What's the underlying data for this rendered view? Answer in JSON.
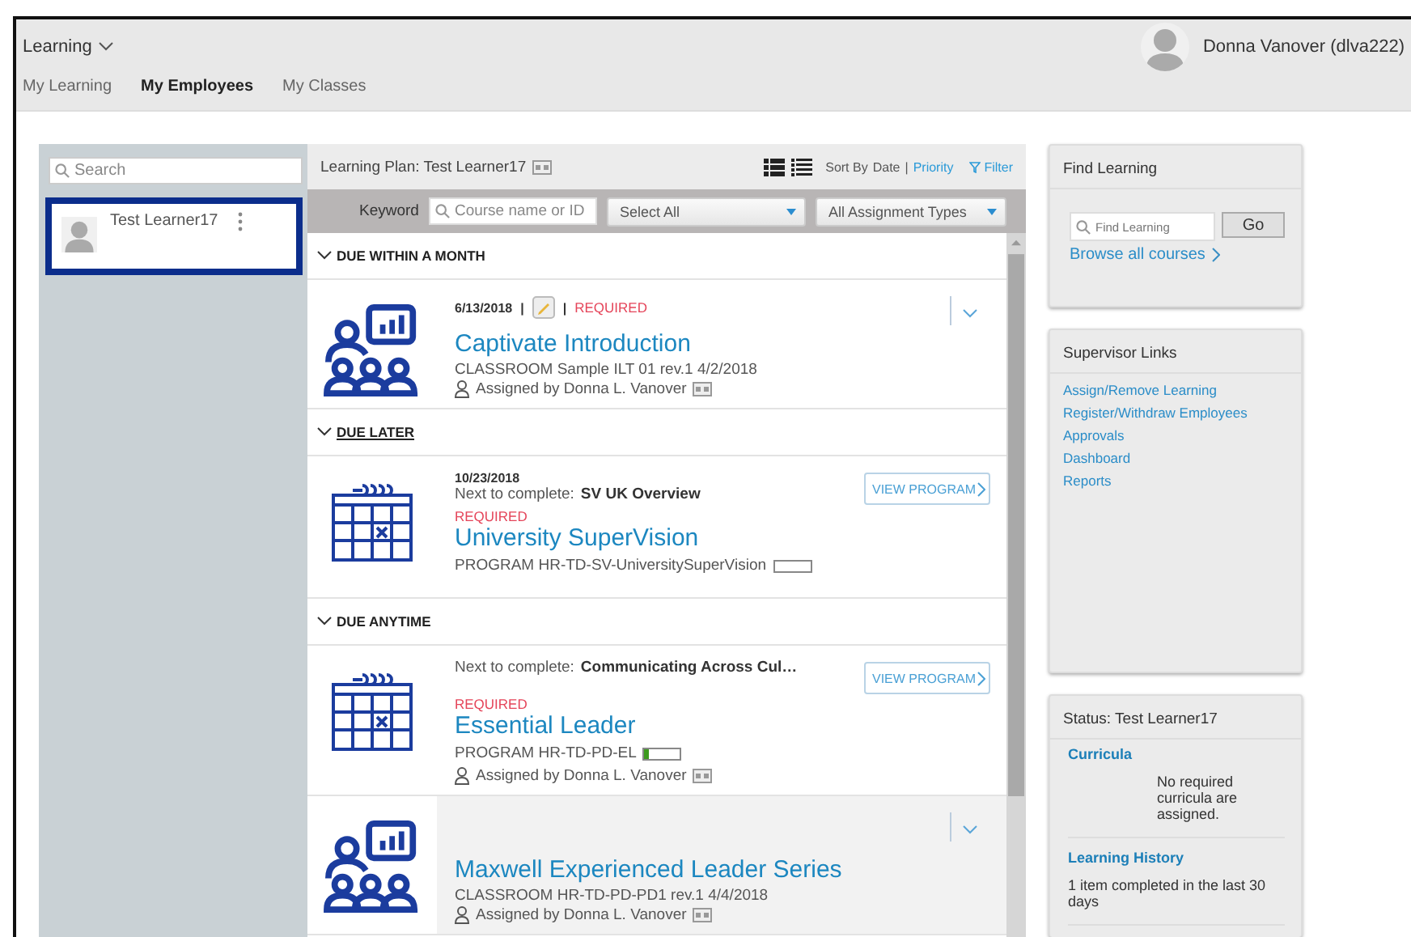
{
  "header": {
    "app_menu": "Learning",
    "user": "Donna Vanover (dlva222)",
    "tabs": [
      {
        "label": "My Learning",
        "selected": false
      },
      {
        "label": "My Employees",
        "selected": true
      },
      {
        "label": "My Classes",
        "selected": false
      }
    ]
  },
  "employees": {
    "search": {
      "placeholder": "Search"
    },
    "list": [
      {
        "name": "Test Learner17",
        "selected": true
      }
    ]
  },
  "plan": {
    "title": "Learning Plan: Test Learner17",
    "sort_label": "Sort By",
    "sort_options": [
      {
        "label": "Date",
        "selected": true
      },
      {
        "label": "Priority",
        "selected": false
      }
    ],
    "separator": "|",
    "filter": "Filter",
    "keyword_label": "Keyword",
    "keyword": {
      "placeholder": "Course name or ID"
    },
    "status_select": "Select All",
    "type_select": "All Assignment Types",
    "sections": [
      {
        "title": "DUE WITHIN A MONTH",
        "focused": false,
        "items": [
          {
            "kind": "course",
            "highlighted": false,
            "date": "6/13/2018",
            "separator": "|",
            "required": "REQUIRED",
            "title": "Captivate Introduction",
            "subtitle": "CLASSROOM Sample ILT 01 rev.1 4/2/2018",
            "assigned": "Assigned by Donna L. Vanover"
          }
        ]
      },
      {
        "title": "DUE LATER",
        "focused": true,
        "items": [
          {
            "kind": "program",
            "highlighted": false,
            "date": "10/23/2018",
            "next_label": "Next to complete:",
            "next_value": "SV UK Overview",
            "required": "REQUIRED",
            "title": "University SuperVision",
            "code": "PROGRAM HR-TD-SV-UniversitySuperVision",
            "level": 0,
            "button": "VIEW PROGRAM"
          }
        ]
      },
      {
        "title": "DUE ANYTIME",
        "focused": false,
        "items": [
          {
            "kind": "program",
            "highlighted": false,
            "next_label": "Next to complete:",
            "next_value": "Communicating Across Cul…",
            "required": "REQUIRED",
            "title": "Essential Leader",
            "code": "PROGRAM HR-TD-PD-EL",
            "level": 0.12,
            "assigned": "Assigned by Donna L. Vanover",
            "button": "VIEW PROGRAM"
          },
          {
            "kind": "course",
            "highlighted": true,
            "title": "Maxwell Experienced Leader Series",
            "subtitle": "CLASSROOM HR-TD-PD-PD1 rev.1 4/4/2018",
            "assigned": "Assigned by Donna L. Vanover"
          }
        ]
      }
    ]
  },
  "find_learning": {
    "title": "Find Learning",
    "search": {
      "placeholder": "Find Learning"
    },
    "button": "Go",
    "browse": "Browse all courses"
  },
  "supervisor_links": {
    "title": "Supervisor Links",
    "links": [
      "Assign/Remove Learning",
      "Register/Withdraw Employees",
      "Approvals",
      "Dashboard",
      "Reports"
    ]
  },
  "status": {
    "title": "Status: Test Learner17",
    "sections": [
      {
        "heading": "Curricula",
        "text": "No required curricula are assigned.",
        "indented": true
      },
      {
        "heading": "Learning History",
        "text": "1 item completed in the last 30 days",
        "indented": false
      }
    ]
  }
}
